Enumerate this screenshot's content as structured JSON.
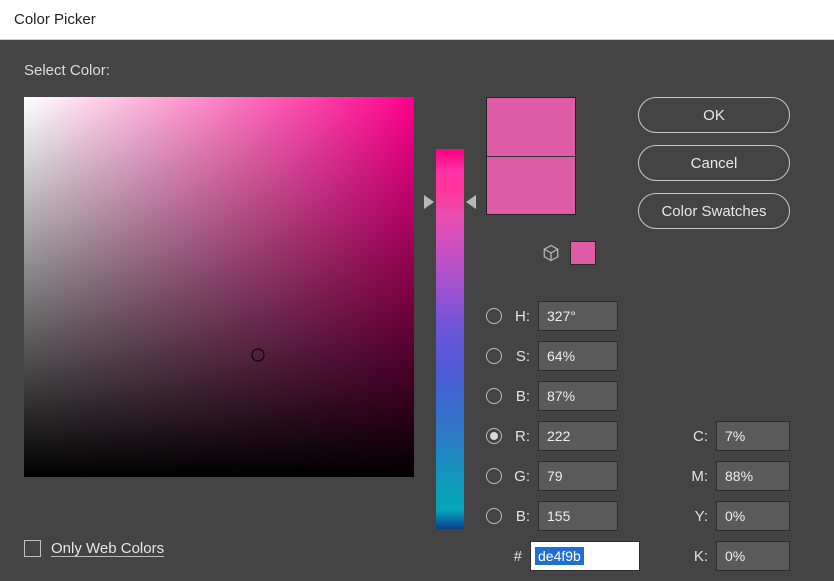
{
  "window": {
    "title": "Color Picker"
  },
  "labels": {
    "select_color": "Select Color:",
    "only_web_colors": "Only Web Colors"
  },
  "buttons": {
    "ok": "OK",
    "cancel": "Cancel",
    "swatches": "Color Swatches"
  },
  "fields": {
    "h": {
      "label": "H:",
      "value": "327°"
    },
    "s": {
      "label": "S:",
      "value": "64%"
    },
    "b": {
      "label": "B:",
      "value": "87%"
    },
    "r": {
      "label": "R:",
      "value": "222"
    },
    "g": {
      "label": "G:",
      "value": "79"
    },
    "b2": {
      "label": "B:",
      "value": "155"
    },
    "hex": {
      "label": "#",
      "value": "de4f9b"
    },
    "c": {
      "label": "C:",
      "value": "7%"
    },
    "m": {
      "label": "M:",
      "value": "88%"
    },
    "y": {
      "label": "Y:",
      "value": "0%"
    },
    "k": {
      "label": "K:",
      "value": "0%"
    }
  },
  "colors": {
    "current": "#de4f9b",
    "preview_top": "#de5ca6",
    "preview_bottom": "#de5ca6",
    "mini_swatch": "#de5ca6",
    "hue_base": "hsl(327,100%,50%)"
  },
  "picker": {
    "sb_marker": {
      "s_pct": 60,
      "b_pct": 68
    },
    "hue_arrow_pct": 14
  },
  "radio_selected": "r",
  "only_web_colors_checked": false
}
